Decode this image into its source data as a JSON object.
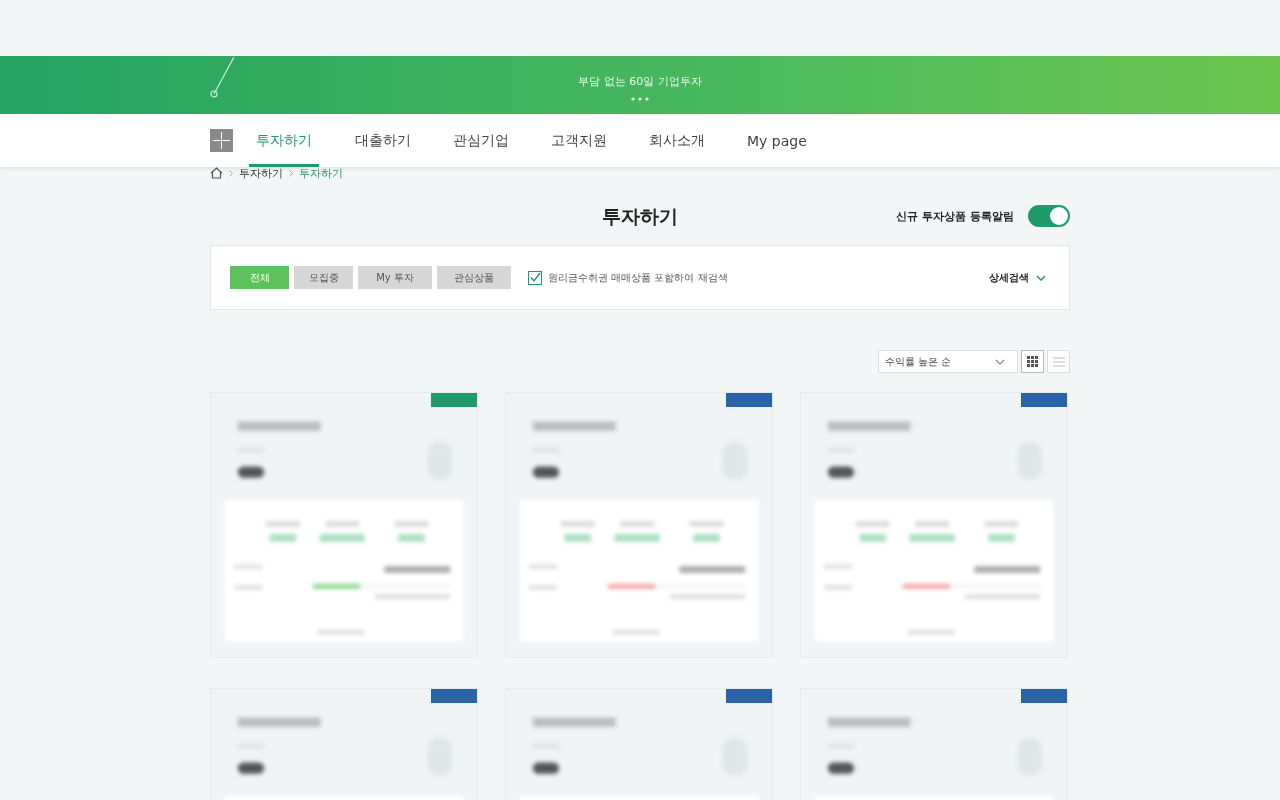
{
  "banner": {
    "subtitle": "부담 없는 60일 기업투자"
  },
  "nav": {
    "items": [
      {
        "label": "투자하기",
        "selected": true
      },
      {
        "label": "대출하기",
        "selected": false
      },
      {
        "label": "관심기업",
        "selected": false
      },
      {
        "label": "고객지원",
        "selected": false
      },
      {
        "label": "회사소개",
        "selected": false
      },
      {
        "label": "My page",
        "selected": false
      }
    ]
  },
  "breadcrumb": [
    {
      "label": "투자하기",
      "selected": false
    },
    {
      "label": "투자하기",
      "selected": true
    }
  ],
  "page_title": "투자하기",
  "alert_toggle": {
    "label": "신규 투자상품 등록알림",
    "on": true
  },
  "filters": {
    "tabs": [
      {
        "label": "전체",
        "selected": true
      },
      {
        "label": "모집중",
        "selected": false
      },
      {
        "label": "My 투자",
        "selected": false
      },
      {
        "label": "관심상품",
        "selected": false
      }
    ],
    "checkbox": {
      "label": "원리금수취권 매매상품 포함하여 재검색",
      "checked": true
    },
    "detail_search": "상세검색"
  },
  "sort": {
    "value": "수익률 높은 순",
    "view_buttons": [
      {
        "kind": "grid",
        "selected": true
      },
      {
        "kind": "list",
        "selected": false
      }
    ]
  },
  "cards": [
    {
      "color": "#1f9a6a"
    },
    {
      "color": "#2a63a8"
    },
    {
      "color": "#2a63a8"
    },
    {
      "color": "#2a63a8"
    },
    {
      "color": "#2a63a8"
    },
    {
      "color": "#2a63a8"
    }
  ]
}
